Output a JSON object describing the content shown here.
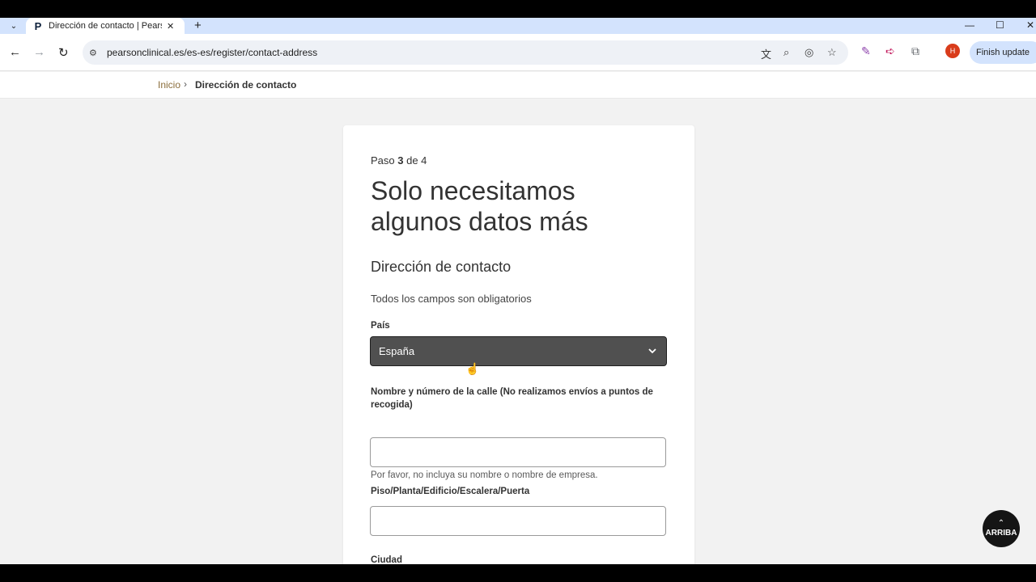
{
  "browser": {
    "tab_title": "Dirección de contacto | Pearson",
    "favicon": "P",
    "url": "pearsonclinical.es/es-es/register/contact-address",
    "finish_update": "Finish update",
    "avatar_initial": "H"
  },
  "breadcrumb": {
    "home": "Inicio",
    "separator": "›",
    "current": "Dirección de contacto"
  },
  "form": {
    "step_prefix": "Paso ",
    "step_current": "3",
    "step_suffix": " de 4",
    "heading": "Solo necesitamos algunos datos más",
    "subheading": "Dirección de contacto",
    "required_note": "Todos los campos son obligatorios",
    "country_label": "País",
    "country_value": "España",
    "street_label": "Nombre y número de la calle (No realizamos envíos a puntos de recogida)",
    "street_value": "",
    "street_hint": "Por favor, no incluya su nombre o nombre de empresa.",
    "floor_label": "Piso/Planta/Edificio/Escalera/Puerta",
    "floor_value": "",
    "city_label": "Ciudad"
  },
  "back_to_top": {
    "label": "ARRIBA"
  },
  "colors": {
    "select_bg": "#505050",
    "breadcrumb_link": "#8a6d3b",
    "page_bg": "#f2f2f2"
  }
}
